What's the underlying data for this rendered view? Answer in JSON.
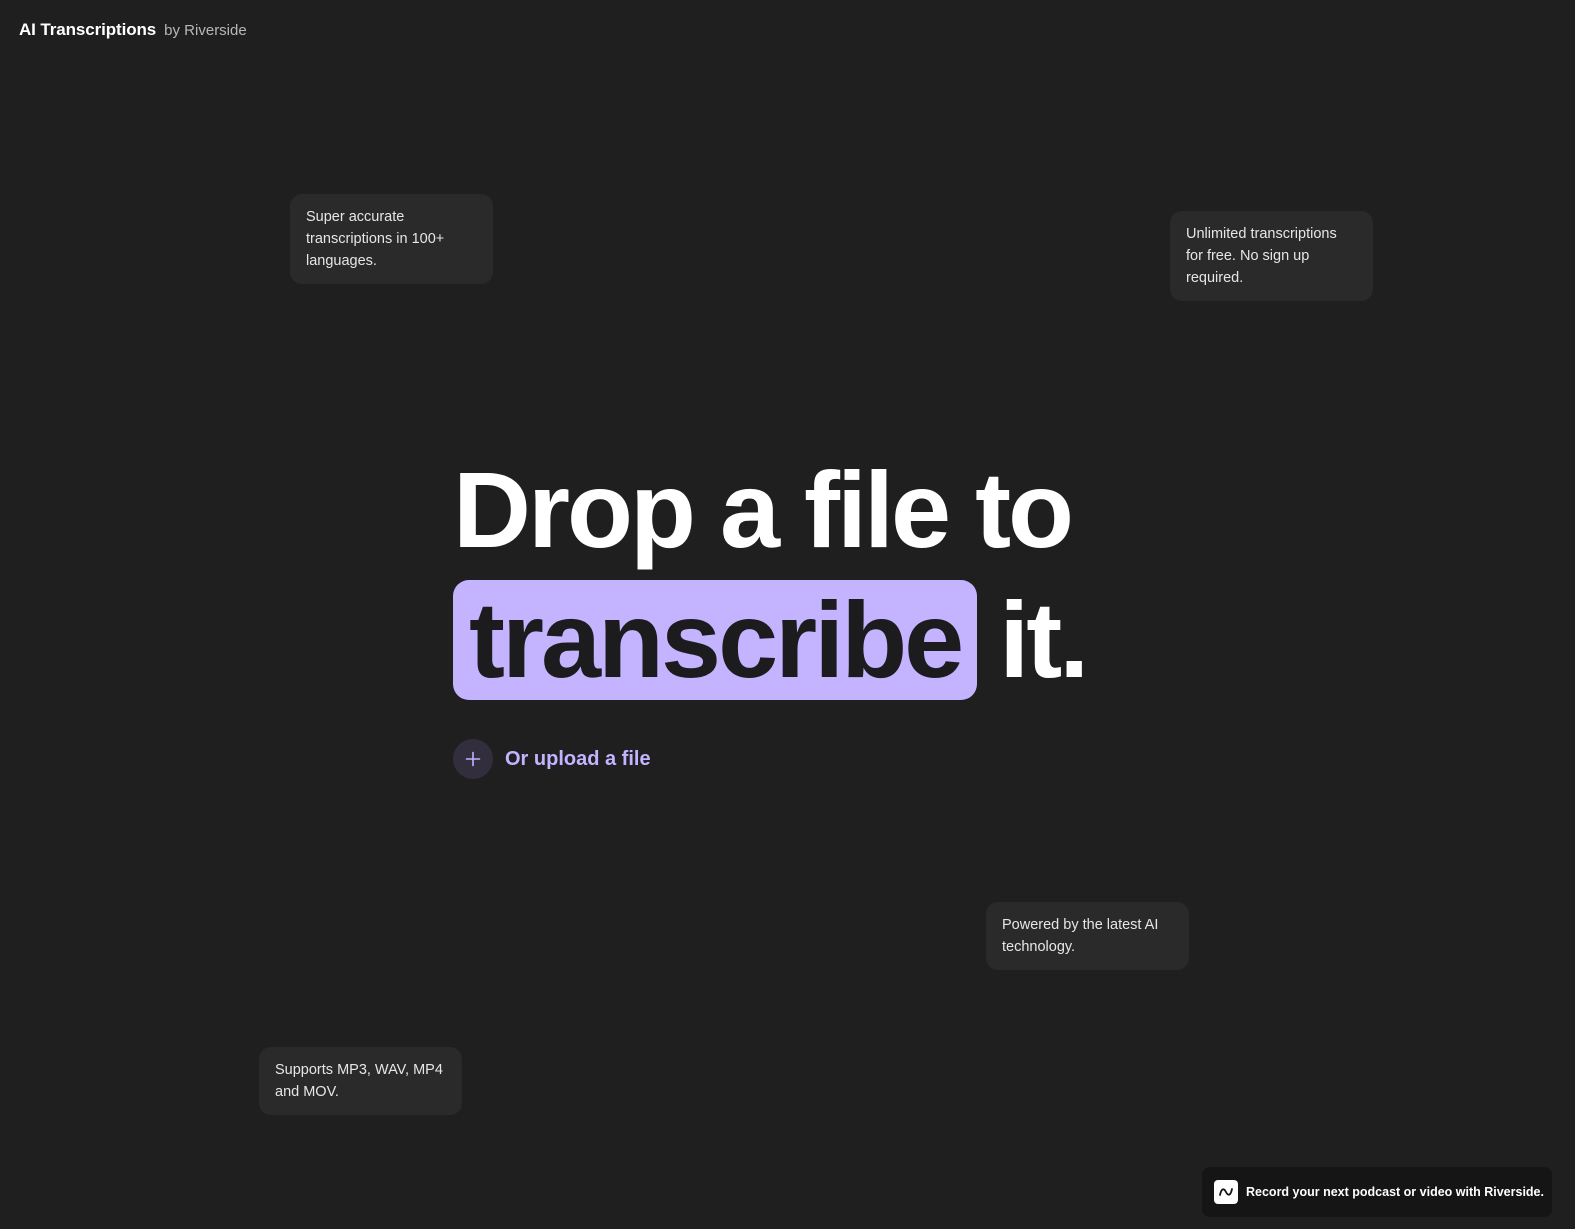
{
  "brand": {
    "name": "AI Transcriptions",
    "by": "by Riverside"
  },
  "tips": [
    "Super accurate transcriptions in 100+ languages.",
    "Unlimited transcriptions for free. No sign up required.",
    "Powered by the latest AI technology.",
    "Supports MP3, WAV, MP4 and MOV."
  ],
  "hero": {
    "line1": "Drop a file to",
    "highlight": "transcribe",
    "line2_tail": "it.",
    "accent_color": "#c4b3ff"
  },
  "upload": {
    "icon": "plus-icon",
    "label": "Or upload a file"
  },
  "promo": {
    "icon": "riverside-logo-icon",
    "text": "Record your next podcast or video with Riverside."
  }
}
